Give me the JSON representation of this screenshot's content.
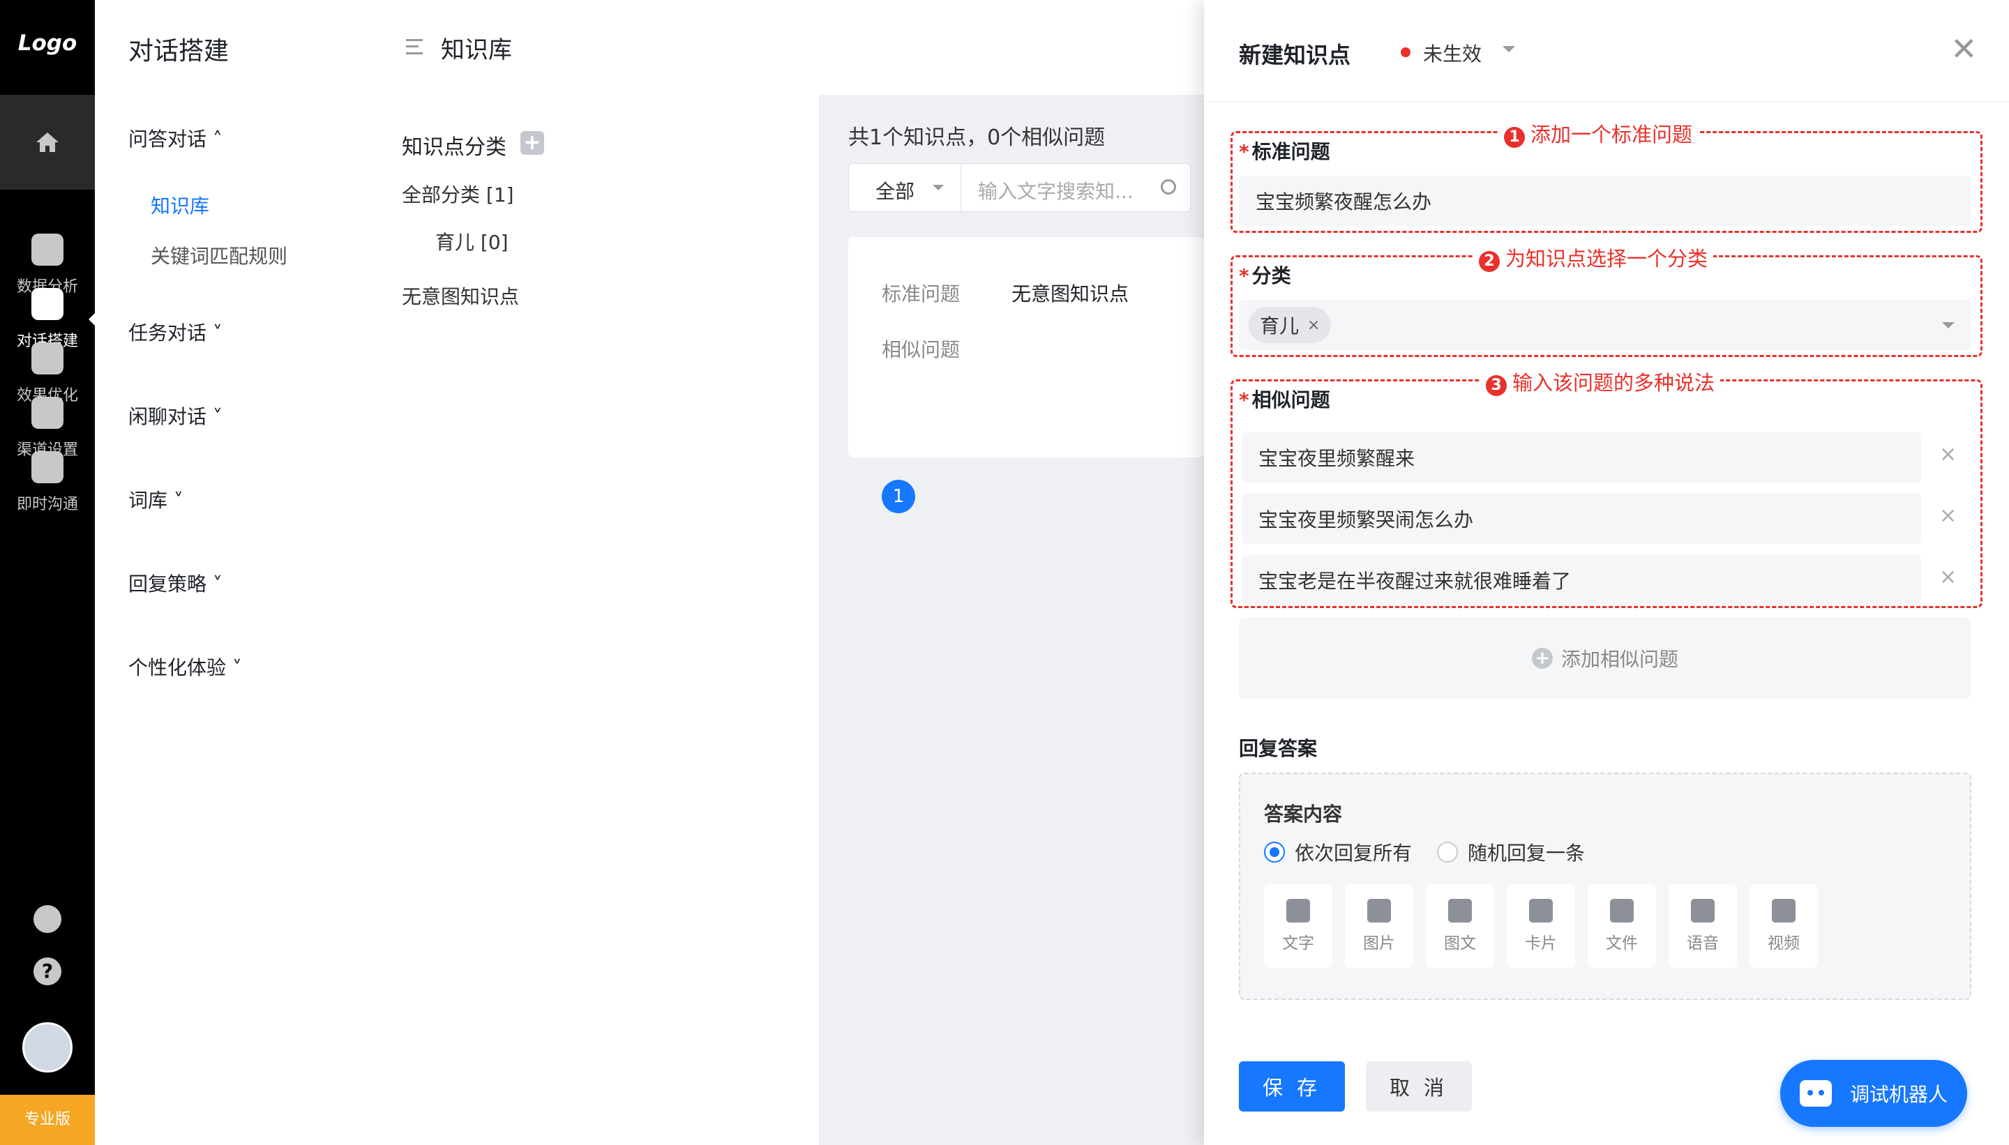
{
  "rail": {
    "logo": "Logo",
    "items": [
      {
        "label": "数据分析",
        "icon": "bar-chart-icon"
      },
      {
        "label": "对话搭建",
        "icon": "robot-icon",
        "active": true
      },
      {
        "label": "效果优化",
        "icon": "cube-icon"
      },
      {
        "label": "渠道设置",
        "icon": "channel-icon"
      },
      {
        "label": "即时沟通",
        "icon": "chat-icon"
      }
    ],
    "help_glyph": "?",
    "edition": "专业版"
  },
  "subnav": {
    "title": "对话搭建",
    "groups": [
      {
        "label": "问答对话 ˄",
        "children": [
          "知识库",
          "关键词匹配规则"
        ]
      },
      {
        "label": "任务对话 ˅"
      },
      {
        "label": "闲聊对话 ˅"
      },
      {
        "label": "词库 ˅"
      },
      {
        "label": "回复策略 ˅"
      },
      {
        "label": "个性化体验 ˅"
      }
    ]
  },
  "topbar": {
    "title": "知识库"
  },
  "category_panel": {
    "title": "知识点分类",
    "add_glyph": "+",
    "items": [
      "全部分类 [1]",
      "育儿 [0]",
      "无意图知识点"
    ]
  },
  "list": {
    "summary": "共1个知识点，0个相似问题",
    "filter_value": "全部",
    "search_placeholder": "输入文字搜索知...",
    "card": {
      "standard_label": "标准问题",
      "standard_value": "无意图知识点",
      "similar_label": "相似问题"
    },
    "page": "1"
  },
  "drawer": {
    "title": "新建知识点",
    "status": "未生效",
    "close_glyph": "✕",
    "annotations": [
      {
        "num": "1",
        "text": "添加一个标准问题"
      },
      {
        "num": "2",
        "text": "为知识点选择一个分类"
      },
      {
        "num": "3",
        "text": "输入该问题的多种说法"
      }
    ],
    "standard_label": "标准问题",
    "standard_value": "宝宝频繁夜醒怎么办",
    "category_label": "分类",
    "category_tag": "育儿",
    "tag_remove_glyph": "×",
    "similar_label": "相似问题",
    "similar": [
      "宝宝夜里频繁醒来",
      "宝宝夜里频繁哭闹怎么办",
      "宝宝老是在半夜醒过来就很难睡着了"
    ],
    "remove_glyph": "×",
    "add_similar": "添加相似问题",
    "add_glyph": "+",
    "reply_title": "回复答案",
    "answer_title": "答案内容",
    "radio_options": [
      "依次回复所有",
      "随机回复一条"
    ],
    "radio_selected": 0,
    "tools": [
      {
        "label": "文字",
        "icon": "text-icon"
      },
      {
        "label": "图片",
        "icon": "image-icon"
      },
      {
        "label": "图文",
        "icon": "article-icon"
      },
      {
        "label": "卡片",
        "icon": "card-icon"
      },
      {
        "label": "文件",
        "icon": "folder-icon"
      },
      {
        "label": "语音",
        "icon": "mic-icon"
      },
      {
        "label": "视频",
        "icon": "video-icon"
      }
    ],
    "save": "保 存",
    "cancel": "取 消"
  },
  "debug_button": "调试机器人",
  "colors": {
    "primary": "#1677ff",
    "annotation": "#e8312a",
    "rail": "#000000",
    "edition": "#f5a623"
  }
}
